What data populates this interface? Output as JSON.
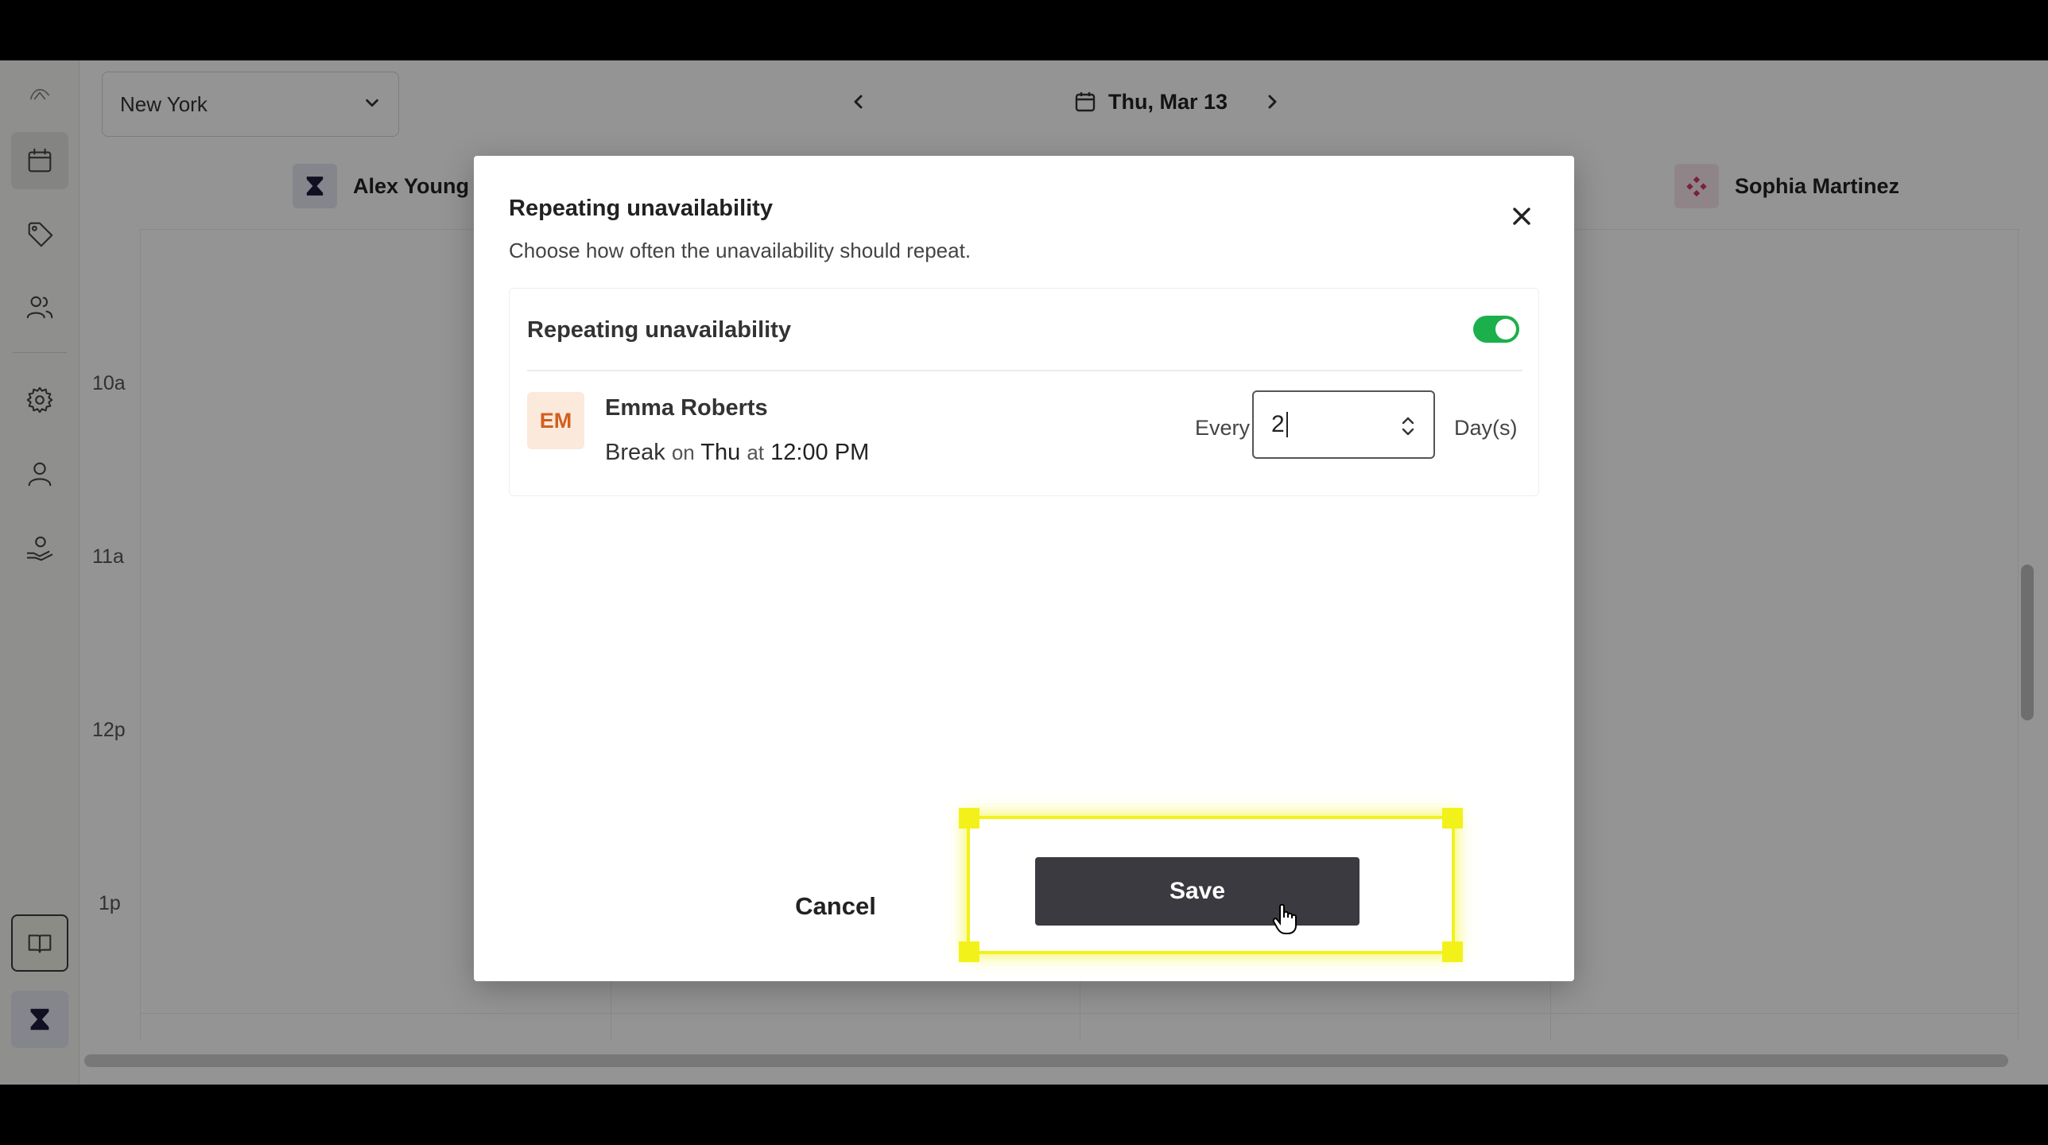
{
  "app": {
    "location_select": {
      "value": "New York"
    },
    "date_nav": {
      "date": "Thu, Mar 13"
    },
    "staff": [
      {
        "name": "Alex Young"
      },
      {
        "name": "Sophia Martinez"
      }
    ],
    "hours": [
      "10a",
      "11a",
      "12p",
      "1p"
    ]
  },
  "modal": {
    "title": "Repeating unavailability",
    "subtitle": "Choose how often the unavailability should repeat.",
    "card": {
      "title": "Repeating unavailability",
      "toggle_on": true,
      "person": {
        "initials": "EM",
        "name": "Emma Roberts",
        "break_type": "Break",
        "on_word": "on",
        "day": "Thu",
        "at_word": "at",
        "time": "12:00 PM"
      },
      "every_label": "Every",
      "interval_value": "2",
      "unit_label": "Day(s)"
    },
    "cancel_label": "Cancel",
    "save_label": "Save"
  },
  "colors": {
    "toggle_on": "#1bb04b",
    "save_bg": "#3a3a40",
    "highlight": "#f2f21a",
    "avatar_bg": "#fbe9dc",
    "avatar_text": "#d25f1e"
  }
}
